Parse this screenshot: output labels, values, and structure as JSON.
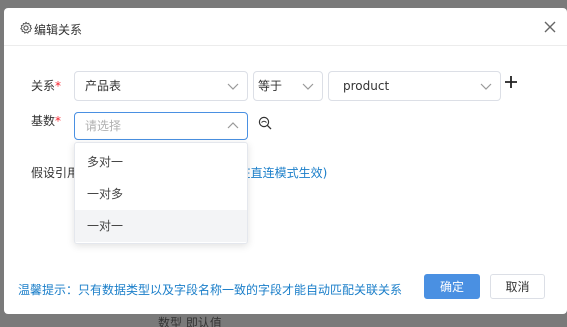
{
  "dialog": {
    "title": "编辑关系",
    "icon": "gear-icon",
    "close_icon": "close-icon"
  },
  "form": {
    "relation_label": "关系",
    "required_mark": "*",
    "table_select_value": "产品表",
    "operator_value": "等于",
    "field_select_value": "product",
    "cardinality_label": "基数",
    "cardinality_placeholder": "请选择",
    "hidden_label_text": "假设引用",
    "hidden_link_text": "(在直连模式生效)"
  },
  "dropdown": {
    "options": [
      "多对一",
      "一对多",
      "一对一"
    ],
    "hovered_index": 2
  },
  "footer": {
    "tip": "温馨提示：只有数据类型以及字段名称一致的字段才能自动匹配关联关系",
    "confirm_label": "确定",
    "cancel_label": "取消"
  },
  "background": {
    "partial_text": "数型 即认值"
  },
  "colors": {
    "primary": "#4a90e2",
    "link": "#1a7ec9",
    "required": "#f5222d",
    "border": "#dcdfe6"
  }
}
